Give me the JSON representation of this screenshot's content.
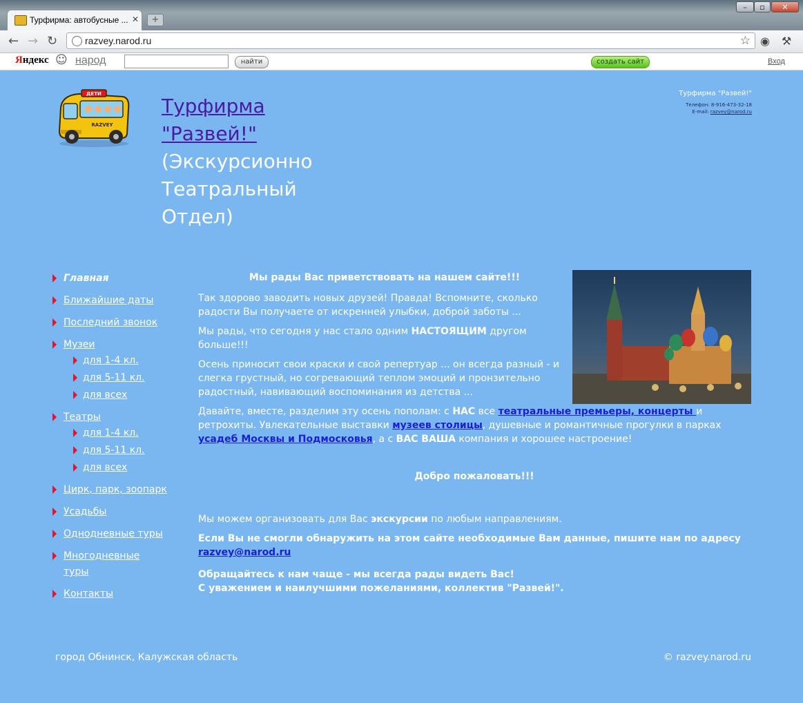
{
  "browser": {
    "tab_title": "Турфирма: автобусные ...",
    "url": "razvey.narod.ru"
  },
  "yandex_bar": {
    "logo_first": "Я",
    "logo_rest": "ндекс",
    "narod": "народ",
    "search_value": "",
    "find_label": "найти",
    "create_label": "создать сайт",
    "exit_label": "Вход"
  },
  "header": {
    "title_line1": "Турфирма",
    "title_line2": "\"Развей!\"",
    "subtitle_line1": "(Экскурсионно",
    "subtitle_line2": "Театральный",
    "subtitle_line3": "Отдел)",
    "bus_sign": "ДЕТИ",
    "bus_label": "RAZVEY"
  },
  "contact": {
    "name": "Турфирма \"Развей!\"",
    "phone": "Телефон: 8-916-473-32-18",
    "email_label": "E-mail: ",
    "email": "razvey@narod.ru"
  },
  "menu": {
    "main": "Главная",
    "dates": "Ближайшие даты",
    "bell": "Последний звонок",
    "museums": "Музеи",
    "museums_1_4": "для 1-4 кл.",
    "museums_5_11": "для 5-11 кл.",
    "museums_all": "для всех",
    "theatres": "Театры",
    "theatres_1_4": "для 1-4 кл.",
    "theatres_5_11": "для 5-11 кл.",
    "theatres_all": "для всех",
    "circus": "Цирк, парк, зоопарк",
    "estates": "Усадьбы",
    "oneday": "Однодневные туры",
    "multiday": "Многодневные туры",
    "contacts": "Контакты"
  },
  "content": {
    "welcome": "Мы рады Вас приветствовать на нашем сайте!!!",
    "p1": "Так здорово заводить новых друзей! Правда! Вспомните, сколько радости Вы получаете от искренней улыбки, доброй заботы ...",
    "p2_a": "Мы рады, что сегодня у нас стало одним ",
    "p2_b": "НАСТОЯЩИМ",
    "p2_c": " другом больше!!!",
    "p3": "Осень приносит свои краски и свой репертуар ... он всегда разный - и слегка грустный, но согревающий теплом эмоций и пронзительно радостный, навивающий воспоминания из детства ...",
    "p4_a": "Давайте, вместе, разделим эту осень пополам: с ",
    "p4_b": "НАС",
    "p4_c": " все ",
    "p4_link1": "театральные премьеры, концерты ",
    "p4_d": "и ретрохиты. Увлекательные выставки ",
    "p4_link2": "музеев столицы",
    "p4_e": ", душевные и романтичные прогулки в парках ",
    "p4_link3": "усадеб Москвы и Подмосковья",
    "p4_f": ", а с ",
    "p4_g": "ВАС ВАША",
    "p4_h": " компания и хорошее настроение!",
    "big_welcome": "Добро пожаловать!!!",
    "p5_a": "Мы можем организовать для Вас ",
    "p5_b": "экскурсии",
    "p5_c": " по любым направлениям.",
    "p6": "Если Вы не смогли обнаружить на этом сайте необходимые Вам данные, пишите нам по адресу ",
    "p6_link": "razvey@narod.ru",
    "p7_line1": "Обращайтесь к нам чаще - мы всегда рады видеть Вас!",
    "p7_line2": "С уважением и наилучшими пожеланиями, коллектив \"Развей!\"."
  },
  "footer": {
    "left": "город Обнинск, Калужская область",
    "right": "© razvey.narod.ru"
  }
}
